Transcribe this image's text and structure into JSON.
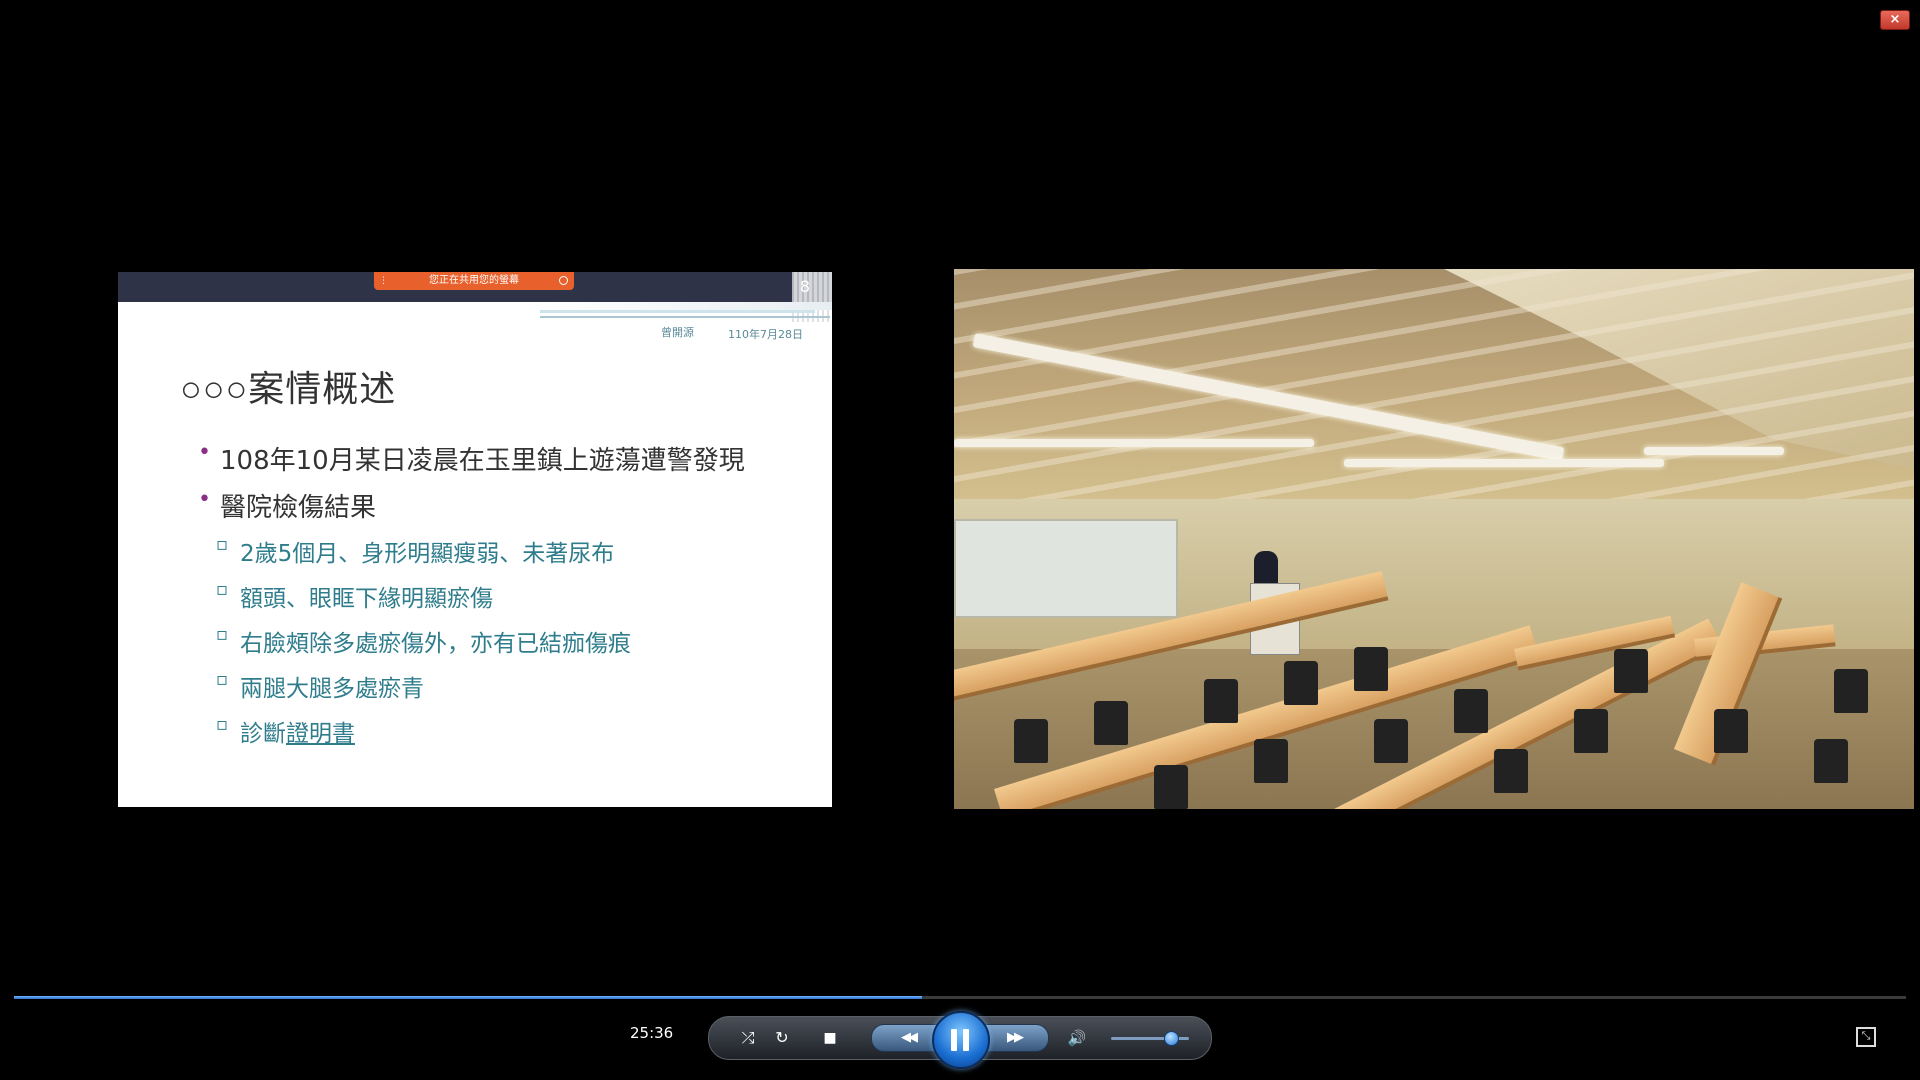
{
  "window": {
    "close_icon": "×"
  },
  "slide": {
    "share_banner": "您正在共用您的螢幕",
    "number": "8",
    "author": "曾開源",
    "date": "110年7月28日",
    "title": "○○○案情概述",
    "bullets": [
      {
        "level": 1,
        "text": "108年10月某日凌晨在玉里鎮上遊蕩遭警發現"
      },
      {
        "level": 1,
        "text": "醫院檢傷結果"
      },
      {
        "level": 2,
        "text": "2歲5個月、身形明顯瘦弱、未著尿布"
      },
      {
        "level": 2,
        "text": "額頭、眼眶下緣明顯瘀傷"
      },
      {
        "level": 2,
        "text": "右臉頰除多處瘀傷外，亦有已結痂傷痕"
      },
      {
        "level": 2,
        "text": "兩腿大腿多處瘀青"
      }
    ],
    "last_bullet_prefix": "診斷",
    "last_bullet_link": "證明書"
  },
  "player": {
    "current_time": "25:36",
    "progress_fraction": 0.48,
    "volume_fraction": 0.75,
    "icons": {
      "shuffle": "⤮",
      "repeat": "↻",
      "stop": "■",
      "rewind": "◀◀",
      "forward": "▶▶",
      "volume": "🔊",
      "fullscreen": "⤡"
    }
  }
}
